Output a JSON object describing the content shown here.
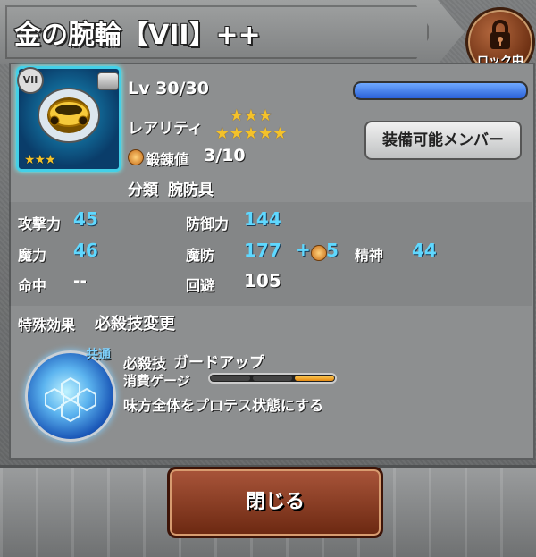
{
  "header": {
    "title": "金の腕輪【VII】++",
    "lock_label": "ロック中"
  },
  "item": {
    "rank_badge": "VII",
    "level": "Lv 30/30",
    "level_progress": 1.0,
    "rarity_label": "レアリティ",
    "rarity_stars": "★★★\n★★★★★",
    "thumb_stars": "★★★",
    "refine_label": "鍛錬値",
    "refine_value": "3/10",
    "category_label": "分類",
    "category_value": "腕防具"
  },
  "equip_button": "装備可能メンバー",
  "stats": {
    "atk_label": "攻撃力",
    "atk_value": "45",
    "def_label": "防御力",
    "def_value": "144",
    "mag_label": "魔力",
    "mag_value": "46",
    "mdef_label": "魔防",
    "mdef_value": "177",
    "mdef_bonus": "+",
    "mdef_bonus_value": "5",
    "spirit_label": "精神",
    "spirit_value": "44",
    "acc_label": "命中",
    "acc_value": "--",
    "eva_label": "回避",
    "eva_value": "105"
  },
  "special": {
    "label": "特殊効果",
    "value": "必殺技変更"
  },
  "skill": {
    "tag": "共通",
    "name_label": "必殺技",
    "name_value": "ガードアップ",
    "gauge_label": "消費ゲージ",
    "gauge_fill": 1,
    "gauge_segments": 3,
    "description": "味方全体をプロテス状態にする"
  },
  "close_button": "閉じる",
  "colors": {
    "accent_cyan": "#5fd8ff",
    "exp_bar": "#2a60d8",
    "star": "#f4c22b",
    "close_btn": "#6b2811"
  }
}
